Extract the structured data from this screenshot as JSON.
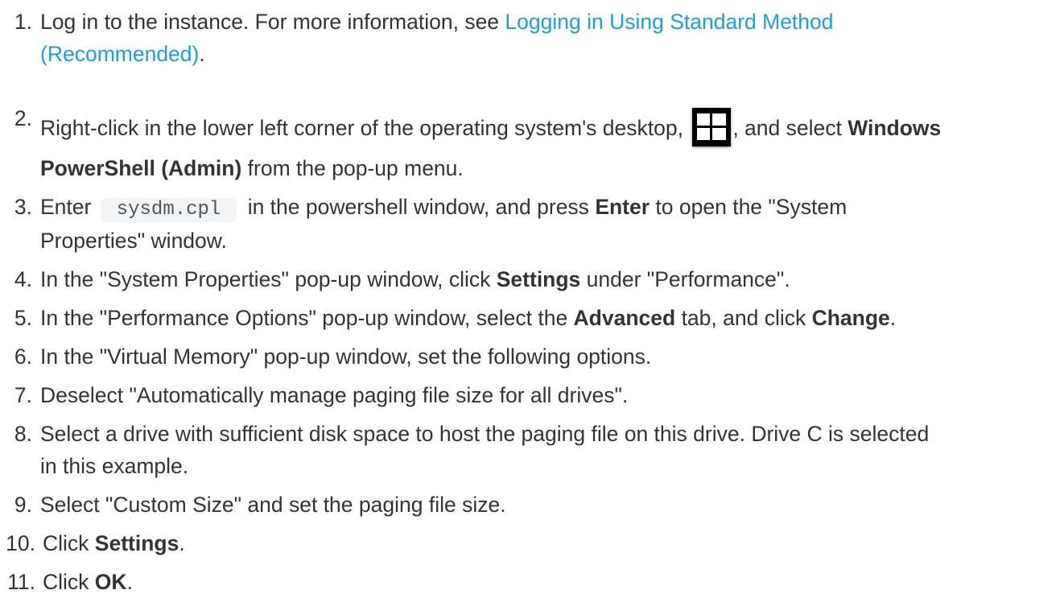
{
  "steps": [
    {
      "number": "1.",
      "text_before": "Log in to the instance. For more information, see ",
      "link_part1": "Logging in Using Standard Method",
      "link_part2": "(Recommended)",
      "text_after": "."
    },
    {
      "number": "2.",
      "text_before": "Right-click in the lower left corner of the operating system's desktop,",
      "icon": "windows-start-icon",
      "text_mid": ", and select ",
      "bold1": "Windows",
      "bold2": "PowerShell (Admin)",
      "text_after": " from the pop-up menu."
    },
    {
      "number": "3.",
      "text_before": "Enter ",
      "code": "sysdm.cpl",
      "text_mid": " in the powershell window, and press ",
      "bold": "Enter",
      "text_after": " to open the \"System",
      "text_line2": "Properties\" window."
    },
    {
      "number": "4.",
      "text_before": "In the \"System Properties\" pop-up window, click ",
      "bold": "Settings",
      "text_after": " under \"Performance\"."
    },
    {
      "number": "5.",
      "text_before": "In the \"Performance Options\" pop-up window, select the ",
      "bold1": "Advanced",
      "text_mid": " tab, and click ",
      "bold2": "Change",
      "text_after": "."
    },
    {
      "number": "6.",
      "text": "In the \"Virtual Memory\" pop-up window, set the following options."
    },
    {
      "number": "7.",
      "text": "Deselect \"Automatically manage paging file size for all drives\"."
    },
    {
      "number": "8.",
      "text_line1": "Select a drive with sufficient disk space to host the paging file on this drive. Drive C is selected",
      "text_line2": "in this example."
    },
    {
      "number": "9.",
      "text": "Select \"Custom Size\" and set the paging file size."
    },
    {
      "number": "10.",
      "text_before": "Click ",
      "bold": "Settings",
      "text_after": "."
    },
    {
      "number": "11.",
      "text_before": "Click ",
      "bold": "OK",
      "text_after": "."
    }
  ],
  "colors": {
    "text": "#333333",
    "link": "#1ca0dc",
    "code_bg": "#f3f4f6"
  }
}
